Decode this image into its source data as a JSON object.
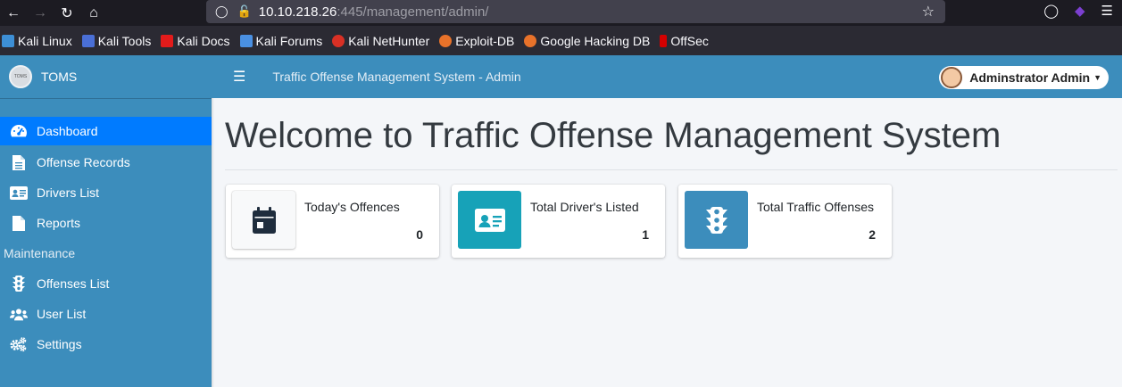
{
  "browser": {
    "url_host": "10.10.218.26",
    "url_rest": ":445/management/admin/",
    "bookmarks": [
      {
        "label": "Kali Linux",
        "color": "#3d8fd6"
      },
      {
        "label": "Kali Tools",
        "color": "#d9534f"
      },
      {
        "label": "Kali Docs",
        "color": "#e31b1b"
      },
      {
        "label": "Kali Forums",
        "color": "#4a90e2"
      },
      {
        "label": "Kali NetHunter",
        "color": "#d93025"
      },
      {
        "label": "Exploit-DB",
        "color": "#e8722a"
      },
      {
        "label": "Google Hacking DB",
        "color": "#e8722a"
      },
      {
        "label": "OffSec",
        "color": "#d40000"
      }
    ]
  },
  "app": {
    "brand": "TOMS",
    "logo_text": "TOMS",
    "nav_title": "Traffic Offense Management System - Admin",
    "user_name": "Adminstrator Admin",
    "accent": "#3c8dbc",
    "active_color": "#007bff"
  },
  "sidebar": {
    "items": [
      {
        "label": "Dashboard",
        "icon": "tachometer-icon"
      },
      {
        "label": "Offense Records",
        "icon": "file-icon"
      },
      {
        "label": "Drivers List",
        "icon": "id-card-icon"
      },
      {
        "label": "Reports",
        "icon": "file-icon"
      }
    ],
    "maintenance_header": "Maintenance",
    "maintenance_items": [
      {
        "label": "Offenses List",
        "icon": "traffic-light-icon"
      },
      {
        "label": "User List",
        "icon": "users-icon"
      },
      {
        "label": "Settings",
        "icon": "cogs-icon"
      }
    ]
  },
  "main": {
    "title": "Welcome to Traffic Offense Management System",
    "cards": [
      {
        "label": "Today's Offences",
        "value": "0",
        "icon": "calendar-icon",
        "color": "#f8f9fa"
      },
      {
        "label": "Total Driver's Listed",
        "value": "1",
        "icon": "id-card-icon",
        "color": "#17a2b8"
      },
      {
        "label": "Total Traffic Offenses",
        "value": "2",
        "icon": "traffic-light-icon",
        "color": "#3c8dbc"
      }
    ]
  }
}
